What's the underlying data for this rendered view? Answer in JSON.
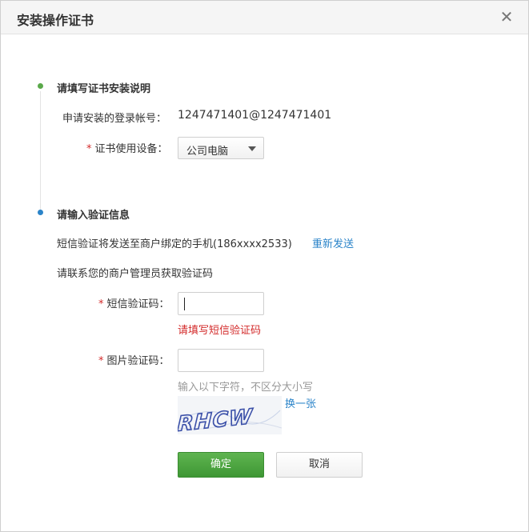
{
  "dialog": {
    "title": "安装操作证书",
    "close_icon": "close-icon"
  },
  "section1": {
    "title": "请填写证书安装说明",
    "account_label": "申请安装的登录帐号：",
    "account_value": "1247471401@1247471401",
    "required_mark": "*",
    "device_label": "证书使用设备：",
    "device_value": "公司电脑"
  },
  "section2": {
    "title": "请输入验证信息",
    "sms_notice": "短信验证将发送至商户绑定的手机(186xxxx2533)",
    "resend_label": "重新发送",
    "contact_notice": "请联系您的商户管理员获取验证码",
    "required_mark": "*",
    "sms_label": "短信验证码：",
    "sms_value": "",
    "sms_error": "请填写短信验证码",
    "image_label": "图片验证码：",
    "image_value": "",
    "image_hint": "输入以下字符，不区分大小写",
    "refresh_label": "换一张",
    "captcha_text": "RHCW"
  },
  "buttons": {
    "confirm": "确定",
    "cancel": "取消"
  },
  "colors": {
    "primary": "#4ca53f",
    "link": "#2b84c9",
    "error": "#d32a2a",
    "dot_done": "#5aa94a",
    "dot_active": "#2b84c9"
  }
}
